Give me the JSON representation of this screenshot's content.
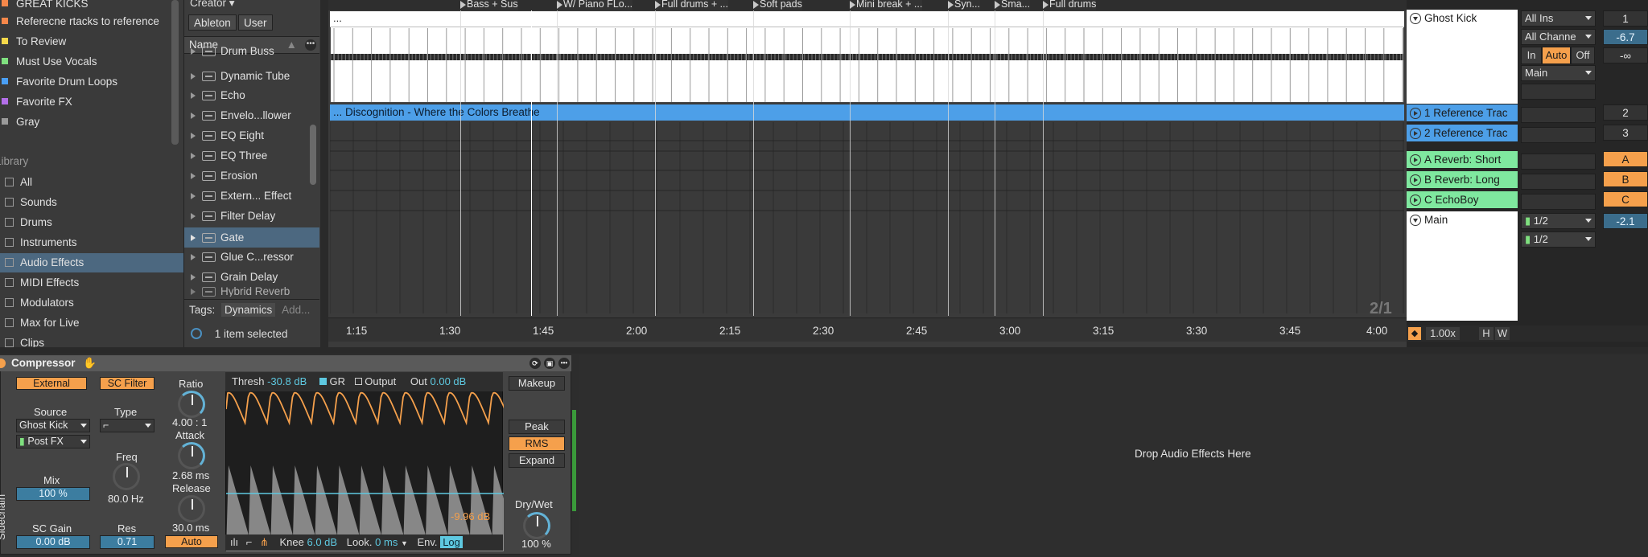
{
  "collections": [
    {
      "label": "GREAT KICKS",
      "color": "#f5874a"
    },
    {
      "label": "Referecne rtacks to reference",
      "color": "#f5874a"
    },
    {
      "label": "To Review",
      "color": "#f5d84a"
    },
    {
      "label": "Must Use Vocals",
      "color": "#7fe07f"
    },
    {
      "label": "Favorite Drum Loops",
      "color": "#4a9ff5"
    },
    {
      "label": "Favorite FX",
      "color": "#b36fe8"
    },
    {
      "label": "Gray",
      "color": "#9a9a9a"
    }
  ],
  "library": {
    "heading": "Library",
    "items": [
      "All",
      "Sounds",
      "Drums",
      "Instruments",
      "Audio Effects",
      "MIDI Effects",
      "Modulators",
      "Max for Live",
      "Clips"
    ],
    "active": "Audio Effects"
  },
  "browser": {
    "creator_label": "Creator ▾",
    "tab_ableton": "Ableton",
    "tab_user": "User",
    "name_header": "Name",
    "devices": [
      "Drum Buss",
      "Dynamic Tube",
      "Echo",
      "Envelo...llower",
      "EQ Eight",
      "EQ Three",
      "Erosion",
      "Extern... Effect",
      "Filter Delay",
      "Gate",
      "Glue C...ressor",
      "Grain Delay",
      "Hybrid Reverb"
    ],
    "active_device": "Gate",
    "tags_label": "Tags:",
    "tag_selected": "Dynamics",
    "tag_add": "Add...",
    "status": "1 item selected"
  },
  "arrangement": {
    "locators": [
      "Bass + Sus",
      "W/ Piano FLo...",
      "Full drums + ...",
      "Soft pads",
      "Mini break + ...",
      "Syn...",
      "Sma...",
      "Full drums"
    ],
    "midi_clip_label": "...",
    "audio_clip_label": "... Discognition - Where the Colors Breathe",
    "ruler_ticks": [
      "1:15",
      "1:30",
      "1:45",
      "2:00",
      "2:15",
      "2:30",
      "2:45",
      "3:00",
      "3:15",
      "3:30",
      "3:45",
      "4:00"
    ],
    "zoom_label": "2/1",
    "zoom_value": "1.00x",
    "h_btn": "H",
    "w_btn": "W"
  },
  "tracks": [
    {
      "name": "Ghost Kick",
      "color": "#ffffff",
      "number": "1"
    },
    {
      "name": "1 Reference Trac",
      "color": "#4d9fe8",
      "number": "2"
    },
    {
      "name": "2 Reference Trac",
      "color": "#4d9fe8",
      "number": "3"
    },
    {
      "name": "A Reverb: Short",
      "color": "#7fe89f",
      "number": "A"
    },
    {
      "name": "B Reverb: Long",
      "color": "#7fe89f",
      "number": "B"
    },
    {
      "name": "C EchoBoy",
      "color": "#7fe89f",
      "number": "C"
    },
    {
      "name": "Main",
      "color": "#ffffff",
      "number": "-2.1"
    }
  ],
  "io": {
    "input_type": "All Ins",
    "input_channel": "All Channe",
    "monitor_in": "In",
    "monitor_auto": "Auto",
    "monitor_off": "Off",
    "output": "Main",
    "volume": "-6.7",
    "neg_inf": "-∞",
    "main_out_1": "1/2",
    "main_out_2": "1/2"
  },
  "compressor": {
    "title": "Compressor",
    "external_btn": "External",
    "sc_filter_btn": "SC Filter",
    "source_label": "Source",
    "source_value": "Ghost Kick",
    "post_fx": "Post FX",
    "type_label": "Type",
    "freq_label": "Freq",
    "freq_value": "80.0 Hz",
    "mix_label": "Mix",
    "mix_value": "100 %",
    "sc_gain_label": "SC Gain",
    "sc_gain_value": "0.00 dB",
    "res_label": "Res",
    "res_value": "0.71",
    "sidechain_label": "Sidechain",
    "ratio_label": "Ratio",
    "ratio_value": "4.00 : 1",
    "attack_label": "Attack",
    "attack_value": "2.68 ms",
    "release_label": "Release",
    "release_value": "30.0 ms",
    "release_auto": "Auto",
    "thresh_label": "Thresh",
    "thresh_value": "-30.8 dB",
    "gr_label": "GR",
    "output_label": "Output",
    "out_label": "Out",
    "out_value": "0.00 dB",
    "gr_readout": "-9.96 dB",
    "knee_label": "Knee",
    "knee_value": "6.0 dB",
    "look_label": "Look.",
    "look_value": "0 ms",
    "env_label": "Env.",
    "env_value": "Log",
    "makeup_btn": "Makeup",
    "peak_btn": "Peak",
    "rms_btn": "RMS",
    "expand_btn": "Expand",
    "drywet_label": "Dry/Wet",
    "drywet_value": "100 %"
  },
  "drop_zone": "Drop Audio Effects Here"
}
